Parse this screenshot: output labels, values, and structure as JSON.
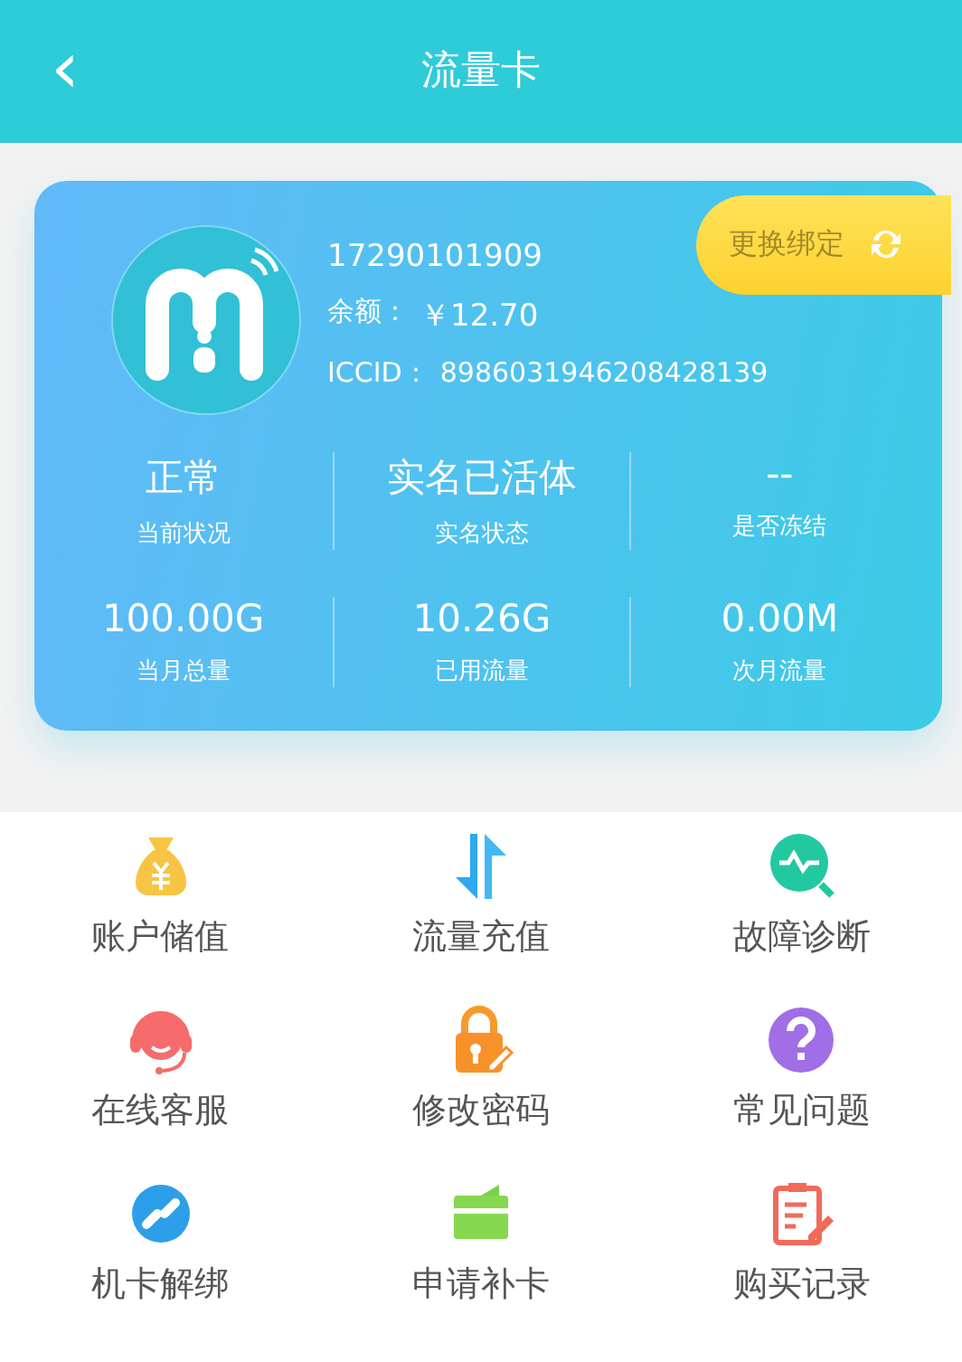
{
  "header": {
    "back": "‹",
    "title": "流量卡"
  },
  "card": {
    "phone": "17290101909",
    "balance_label": "余额：",
    "balance": "￥12.70",
    "iccid_label": "ICCID：",
    "iccid": "8986031946208428139",
    "rebind_button": "更换绑定",
    "stats": [
      {
        "value": "正常",
        "label": "当前状况"
      },
      {
        "value": "实名已活体",
        "label": "实名状态"
      },
      {
        "value": "--",
        "label": "是否冻结"
      },
      {
        "value": "100.00G",
        "label": "当月总量"
      },
      {
        "value": "10.26G",
        "label": "已用流量"
      },
      {
        "value": "0.00M",
        "label": "次月流量"
      }
    ]
  },
  "menu": [
    {
      "kind": "moneybag",
      "label": "账户储值"
    },
    {
      "kind": "arrows",
      "label": "流量充值"
    },
    {
      "kind": "diagnose",
      "label": "故障诊断"
    },
    {
      "kind": "headset",
      "label": "在线客服"
    },
    {
      "kind": "lock",
      "label": "修改密码"
    },
    {
      "kind": "question",
      "label": "常见问题"
    },
    {
      "kind": "link",
      "label": "机卡解绑"
    },
    {
      "kind": "card",
      "label": "申请补卡"
    },
    {
      "kind": "clipboard",
      "label": "购买记录"
    }
  ]
}
